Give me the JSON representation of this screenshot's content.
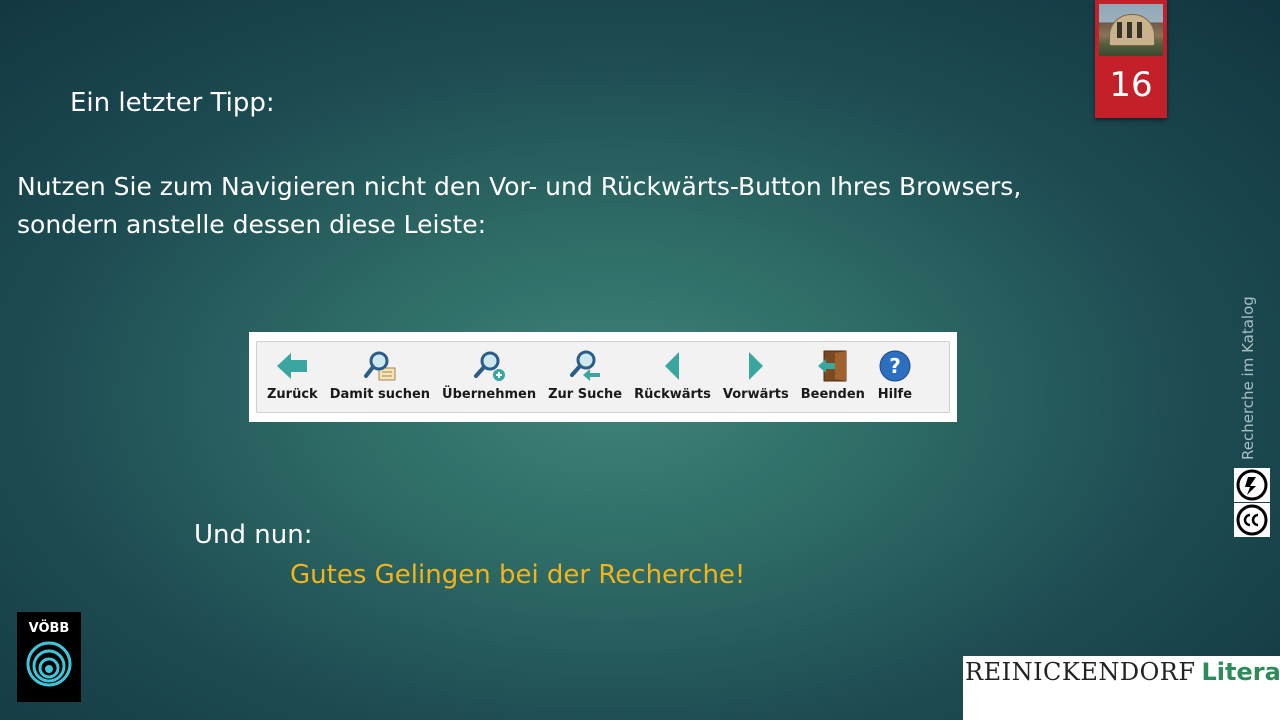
{
  "slide": {
    "number": "16",
    "heading": "Ein letzter Tipp:",
    "instruction_line1": "Nutzen Sie zum Navigieren nicht den Vor- und Rückwärts-Button Ihres Browsers,",
    "instruction_line2": "sondern anstelle dessen diese Leiste:",
    "closing_line1": "Und nun:",
    "closing_line2": "Gutes Gelingen bei der Recherche!",
    "vertical_caption": "Recherche im Katalog"
  },
  "toolbar": {
    "buttons": [
      {
        "label": "Zurück",
        "icon": "back-arrow-icon"
      },
      {
        "label": "Damit suchen",
        "icon": "search-with-icon"
      },
      {
        "label": "Übernehmen",
        "icon": "search-add-icon"
      },
      {
        "label": "Zur Suche",
        "icon": "search-return-icon"
      },
      {
        "label": "Rückwärts",
        "icon": "triangle-left-icon"
      },
      {
        "label": "Vorwärts",
        "icon": "triangle-right-icon"
      },
      {
        "label": "Beenden",
        "icon": "exit-door-icon"
      },
      {
        "label": "Hilfe",
        "icon": "help-icon"
      }
    ]
  },
  "logos": {
    "voebb": "VÖBB",
    "reinickendorf_part1": "REINICKENDORF",
    "reinickendorf_part2": "Literatur"
  },
  "colors": {
    "accent_yellow": "#f5b31a",
    "slide_number_red": "#c4202a",
    "toolbar_teal": "#3aa6a0",
    "literatur_green": "#2f8a5a"
  }
}
